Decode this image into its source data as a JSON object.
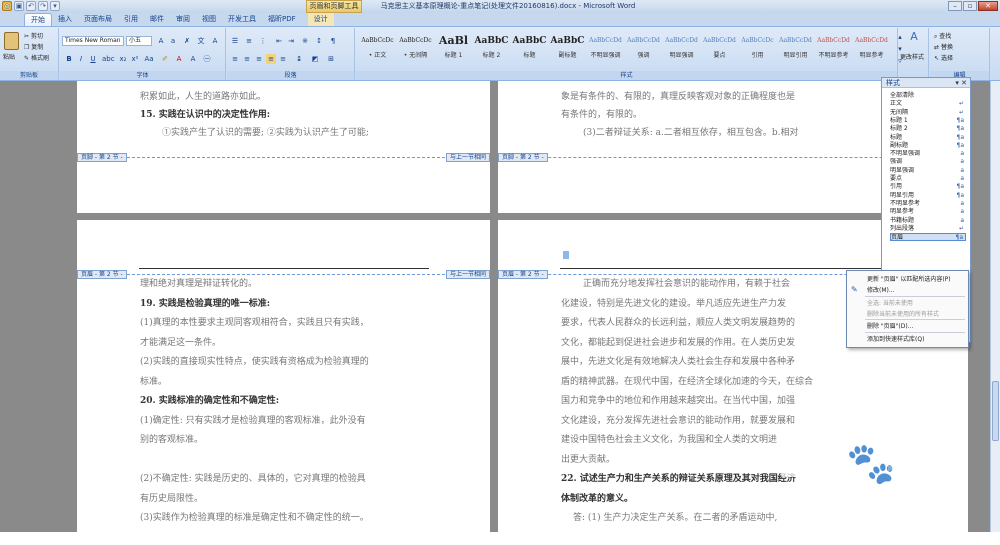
{
  "window": {
    "contextual_tab": "页眉和页脚工具",
    "title": "马克思主义基本原理概论-重点笔记(处理文件20160816).docx - Microsoft Word"
  },
  "tabs": [
    "开始",
    "插入",
    "页面布局",
    "引用",
    "邮件",
    "审阅",
    "视图",
    "开发工具",
    "福昕PDF",
    "设计"
  ],
  "ribbon": {
    "clipboard": {
      "paste": "粘贴",
      "cut": "剪切",
      "copy": "复制",
      "format_painter": "格式刷",
      "label": "剪贴板"
    },
    "font": {
      "name": "Times New Roman",
      "size": "小五",
      "label": "字体"
    },
    "paragraph": {
      "label": "段落"
    },
    "styles": {
      "label": "样式",
      "change_styles": "更改样式",
      "gallery": [
        {
          "sample": "AaBbCcDc",
          "name": "• 正文"
        },
        {
          "sample": "AaBbCcDc",
          "name": "• 无间隔"
        },
        {
          "sample": "AaBl",
          "name": "标题 1"
        },
        {
          "sample": "AaBbC",
          "name": "标题 2"
        },
        {
          "sample": "AaBbC",
          "name": "标题"
        },
        {
          "sample": "AaBbC",
          "name": "副标题"
        },
        {
          "sample": "AaBbCcDd",
          "name": "不明显强调"
        },
        {
          "sample": "AaBbCcDd",
          "name": "强调"
        },
        {
          "sample": "AaBbCcDd",
          "name": "明显强调"
        },
        {
          "sample": "AaBbCcDd",
          "name": "要点"
        },
        {
          "sample": "AaBbCcDc",
          "name": "引用"
        },
        {
          "sample": "AaBbCcDd",
          "name": "明显引用"
        },
        {
          "sample": "AaBbCcDd",
          "name": "不明显参考"
        },
        {
          "sample": "AaBbCcDd",
          "name": "明显参考"
        }
      ]
    },
    "editing": {
      "find": "查找",
      "replace": "替换",
      "select": "选择",
      "label": "编辑"
    }
  },
  "pages": {
    "top_left": {
      "lines": [
        "积累如此，人生的道路亦如此。",
        "15. 实践在认识中的决定性作用:",
        "①实践产生了认识的需要; ②实践为认识产生了可能;"
      ],
      "footer_tag": "页脚 - 第 2 节 -",
      "same_as_prev": "与上一节相同"
    },
    "top_right": {
      "lines": [
        "象是有条件的、有限的，真理反映客观对象的正确程度也是",
        "有条件的，有限的。",
        "(3)二者辩证关系: a.二者相互依存，相互包含。b.相对"
      ],
      "footer_tag": "页脚 - 第 2 节 -",
      "same_as_prev": "与上一节相同"
    },
    "bottom_left": {
      "header_tag": "页眉 - 第 2 节 -",
      "same_as_prev": "与上一节相同",
      "lines": [
        "理和绝对真理是辩证转化的。",
        "19. 实践是检验真理的唯一标准:",
        "(1)真理的本性要求主观同客观相符合，实践且只有实践，",
        "才能满足这一条件。",
        "(2)实践的直接现实性特点，使实践有资格成为检验真理的",
        "标准。",
        "20.   实践标准的确定性和不确定性:",
        "(1)确定性: 只有实践才是检验真理的客观标准，此外没有",
        "别的客观标准。",
        "",
        "(2)不确定性: 实践是历史的、具体的，它对真理的检验具",
        "有历史局限性。",
        "(3)实践作为检验真理的标准是确定性和不确定性的统一。"
      ]
    },
    "bottom_right": {
      "header_tag": "页眉 - 第 2 节 -",
      "same_as_prev": "与上一节相同",
      "lines": [
        "正确而充分地发挥社会意识的能动作用，有赖于社会",
        "化建设，特别是先进文化的建设。举凡适应先进生产力发",
        "要求，代表人民群众的长远利益，顺应人类文明发展趋势的",
        "文化，都能起到促进社会进步和发展的作用。在人类历史发",
        "展中，先进文化是有效地解决人类社会生存和发展中各种矛",
        "盾的精神武器。在现代中国，在经济全球化加速的今天，在综合",
        "国力和竞争中的地位和作用越来越突出。在当代中国，加强",
        "文化建设，充分发挥先进社会意识的能动作用，就要发展和",
        "建设中国特色社会主义文化，为我国和全人类的文明进",
        "出更大贡献。",
        "22. 试述生产力和生产关系的辩证关系原理及其对我国经济",
        "体制改革的意义。",
        "答: (1) 生产力决定生产关系。在二者的矛盾运动中,"
      ]
    }
  },
  "styles_pane": {
    "title": "样式",
    "items": [
      {
        "name": "全部清除",
        "mark": ""
      },
      {
        "name": "正文",
        "mark": "↵"
      },
      {
        "name": "无间隔",
        "mark": "↵"
      },
      {
        "name": "标题 1",
        "mark": "¶a"
      },
      {
        "name": "标题 2",
        "mark": "¶a"
      },
      {
        "name": "标题",
        "mark": "¶a"
      },
      {
        "name": "副标题",
        "mark": "¶a"
      },
      {
        "name": "不明显强调",
        "mark": "a"
      },
      {
        "name": "强调",
        "mark": "a"
      },
      {
        "name": "明显强调",
        "mark": "a"
      },
      {
        "name": "要点",
        "mark": "a"
      },
      {
        "name": "引用",
        "mark": "¶a"
      },
      {
        "name": "明显引用",
        "mark": "¶a"
      },
      {
        "name": "不明显参考",
        "mark": "a"
      },
      {
        "name": "明显参考",
        "mark": "a"
      },
      {
        "name": "书籍标题",
        "mark": "a"
      },
      {
        "name": "列出段落",
        "mark": "↵"
      },
      {
        "name": "页眉",
        "mark": "¶a"
      }
    ]
  },
  "context_menu": {
    "items": [
      {
        "label": "更新 \"页眉\" 以匹配所选内容(P)",
        "disabled": false
      },
      {
        "label": "修改(M)...",
        "disabled": false
      },
      {
        "label": "全选: 当前未使用",
        "disabled": true
      },
      {
        "label": "删除当前未使用的所有样式",
        "disabled": true
      },
      {
        "label": "删除 \"页眉\"(D)...",
        "disabled": false
      },
      {
        "label": "添加到快速样式库(Q)",
        "disabled": false
      }
    ]
  },
  "watermark": {
    "text": "Bai🐾 经验",
    "sub": "jingyan.baidu.com"
  }
}
